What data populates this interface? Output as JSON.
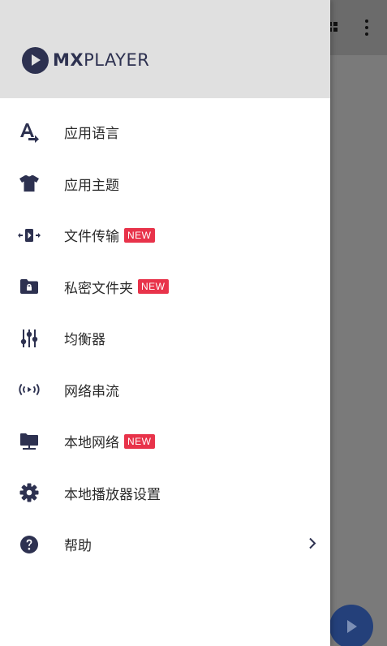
{
  "app": {
    "brand_bold": "MX",
    "brand_light": "PLAYER"
  },
  "menu": {
    "items": [
      {
        "label": "应用语言",
        "icon": "language-icon",
        "badge": ""
      },
      {
        "label": "应用主题",
        "icon": "tshirt-icon",
        "badge": ""
      },
      {
        "label": "文件传输",
        "icon": "file-transfer-icon",
        "badge": "NEW"
      },
      {
        "label": "私密文件夹",
        "icon": "locked-folder-icon",
        "badge": "NEW"
      },
      {
        "label": "均衡器",
        "icon": "equalizer-icon",
        "badge": ""
      },
      {
        "label": "网络串流",
        "icon": "stream-icon",
        "badge": ""
      },
      {
        "label": "本地网络",
        "icon": "local-network-icon",
        "badge": "NEW"
      },
      {
        "label": "本地播放器设置",
        "icon": "gear-icon",
        "badge": ""
      },
      {
        "label": "帮助",
        "icon": "help-icon",
        "badge": ""
      }
    ]
  },
  "colors": {
    "icon": "#2d3150",
    "badge": "#e8334a",
    "header_bg": "#e0e0e0",
    "fab": "#24407a"
  }
}
